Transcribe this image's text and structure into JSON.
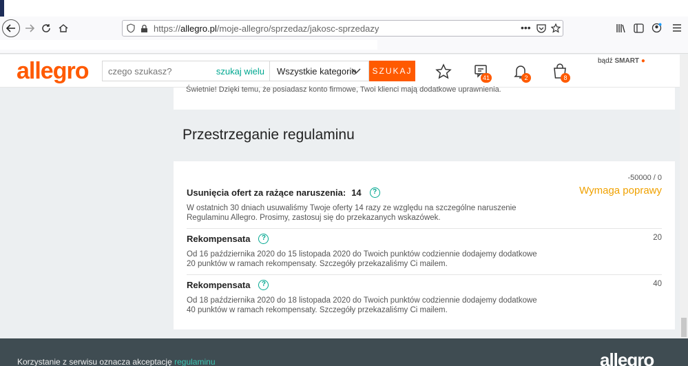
{
  "browser": {
    "url_prefix": "https://",
    "url_domain": "allegro.pl",
    "url_path": "/moje-allegro/sprzedaz/jakosc-sprzedazy"
  },
  "header": {
    "logo": "allegro",
    "search_placeholder": "czego szukasz?",
    "search_many": "szukaj wielu",
    "category": "Wszystkie kategorie",
    "search_button": "SZUKAJ",
    "messages_badge": "41",
    "notifications_badge": "2",
    "cart_badge": "8",
    "smart_prefix": "bądź",
    "smart_label": "SMART"
  },
  "top_card": {
    "text": "Świetnie! Dzięki temu, że posiadasz konto firmowe, Twoi klienci mają dodatkowe uprawnienia."
  },
  "section": {
    "title": "Przestrzeganie regulaminu",
    "score": "-50000 / 0",
    "status": "Wymaga poprawy",
    "items": [
      {
        "title": "Usunięcia ofert za rażące naruszenia:",
        "count": "14",
        "desc": "W ostatnich 30 dniach usuwaliśmy Twoje oferty 14 razy ze względu na szczególne naruszenie Regulaminu Allegro. Prosimy, zastosuj się do przekazanych wskazówek.",
        "value": ""
      },
      {
        "title": "Rekompensata",
        "count": "",
        "desc": "Od 16 października 2020 do 15 listopada 2020 do Twoich punktów codziennie dodajemy dodatkowe 20 punktów w ramach rekompensaty. Szczegóły przekazaliśmy Ci mailem.",
        "value": "20"
      },
      {
        "title": "Rekompensata",
        "count": "",
        "desc": "Od 18 października 2020 do 18 listopada 2020 do Twoich punktów codziennie dodajemy dodatkowe 40 punktów w ramach rekompensaty. Szczegóły przekazaliśmy Ci mailem.",
        "value": "40"
      }
    ]
  },
  "footer": {
    "text": "Korzystanie z serwisu oznacza akceptację",
    "link": "regulaminu",
    "logo": "allegro"
  },
  "colors": {
    "brand": "#ff5a00",
    "teal": "#00a790",
    "warning": "#f0a100"
  }
}
